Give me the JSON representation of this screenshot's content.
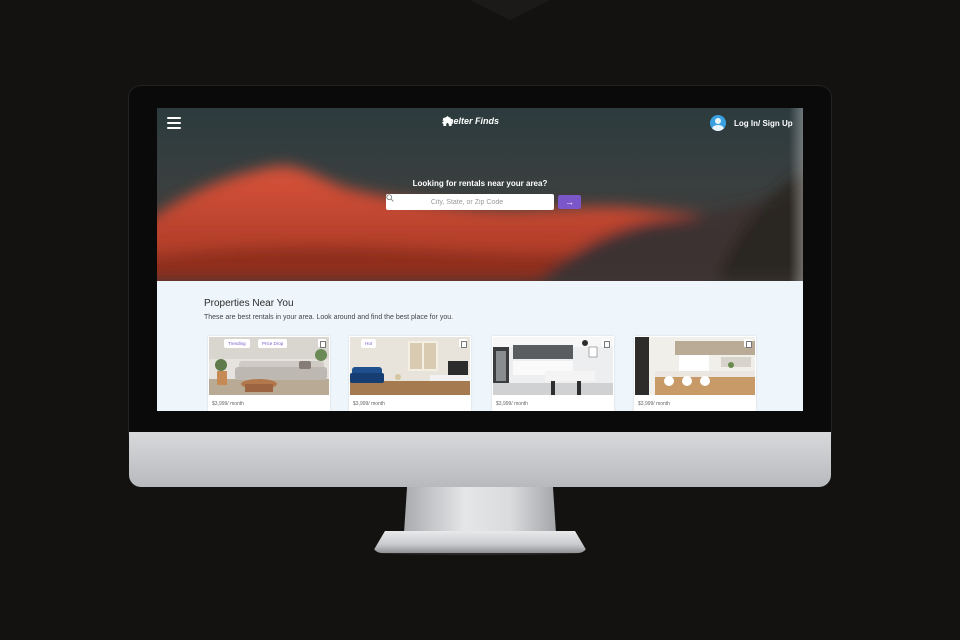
{
  "header": {
    "brand_name": "Shelter Finds",
    "login_label": "Log In/ Sign Up"
  },
  "hero": {
    "question": "Looking for rentals near your area?",
    "search_placeholder": "City, State, or Zip Code",
    "search_button_symbol": "→"
  },
  "properties": {
    "title": "Properties Near You",
    "subtitle": "These are best rentals in your area. Look around and find the best place for you.",
    "cards": [
      {
        "tags": [
          "Trending",
          "Price Drop"
        ],
        "price": "$3,999/ month"
      },
      {
        "tags": [
          "Hot"
        ],
        "price": "$3,999/ month"
      },
      {
        "tags": [],
        "price": "$3,999/ month"
      },
      {
        "tags": [],
        "price": "$3,999/ month"
      }
    ]
  },
  "colors": {
    "accent": "#7a56c9",
    "hero_sky": "#2c3b3e",
    "mountain": "#c5452c",
    "section_bg": "#eef6fc"
  },
  "icons": [
    "menu-icon",
    "home-icon",
    "user-avatar-icon",
    "search-icon",
    "arrow-right-icon",
    "bookmark-icon"
  ]
}
